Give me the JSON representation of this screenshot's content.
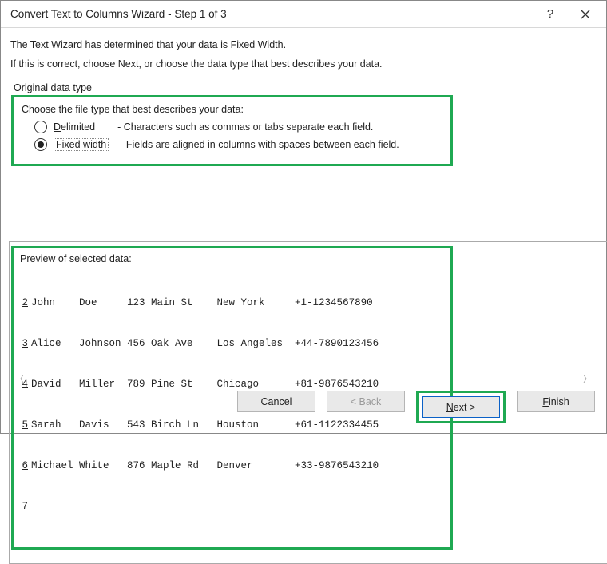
{
  "titlebar": {
    "title": "Convert Text to Columns Wizard - Step 1 of 3"
  },
  "intro": {
    "line1": "The Text Wizard has determined that your data is Fixed Width.",
    "line2": "If this is correct, choose Next, or choose the data type that best describes your data."
  },
  "fieldset": {
    "legend": "Original data type",
    "choose": "Choose the file type that best describes your data:",
    "delimited_label": "Delimited",
    "delimited_desc": "- Characters such as commas or tabs separate each field.",
    "fixed_label": "Fixed width",
    "fixed_desc": "- Fields are aligned in columns with spaces between each field."
  },
  "preview": {
    "label": "Preview of selected data:",
    "rows": [
      {
        "n": "2",
        "text": "John    Doe     123 Main St    New York     +1-1234567890"
      },
      {
        "n": "3",
        "text": "Alice   Johnson 456 Oak Ave    Los Angeles  +44-7890123456"
      },
      {
        "n": "4",
        "text": "David   Miller  789 Pine St    Chicago      +81-9876543210"
      },
      {
        "n": "5",
        "text": "Sarah   Davis   543 Birch Ln   Houston      +61-1122334455"
      },
      {
        "n": "6",
        "text": "Michael White   876 Maple Rd   Denver       +33-9876543210"
      },
      {
        "n": "7",
        "text": ""
      }
    ]
  },
  "buttons": {
    "cancel": "Cancel",
    "back": "< Back",
    "next_pre": "N",
    "next_post": "ext >",
    "finish_pre": "F",
    "finish_post": "inish"
  }
}
